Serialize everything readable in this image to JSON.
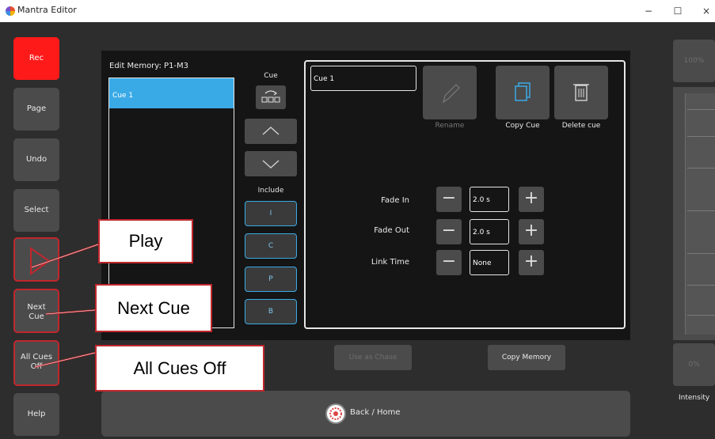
{
  "window": {
    "title": "Mantra Editor",
    "minimize": "−",
    "maximize": "☐",
    "close": "×"
  },
  "sidebar": {
    "rec": "Rec",
    "page": "Page",
    "undo": "Undo",
    "select": "Select",
    "next_cue": "Next\nCue",
    "all_cues_off": "All Cues\nOff",
    "help": "Help"
  },
  "editor": {
    "title": "Edit Memory: P1-M3",
    "cue_list": [
      "Cue 1"
    ],
    "cue_column_label": "Cue",
    "include_label": "Include",
    "include_buttons": [
      "I",
      "C",
      "P",
      "B"
    ]
  },
  "detail": {
    "cue_name": "Cue 1",
    "rename_label": "Rename",
    "copy_cue_label": "Copy Cue",
    "delete_cue_label": "Delete cue",
    "fade_in_label": "Fade In",
    "fade_in_value": "2.0 s",
    "fade_out_label": "Fade Out",
    "fade_out_value": "2.0 s",
    "link_time_label": "Link Time",
    "link_time_value": "None"
  },
  "bottom": {
    "use_as_chase": "Use as Chase",
    "copy_memory": "Copy Memory",
    "back_home": "Back / Home"
  },
  "right": {
    "top_value": "100%",
    "bottom_value": "0%",
    "intensity_label": "Intensity"
  },
  "callouts": {
    "play": "Play",
    "next_cue": "Next Cue",
    "all_cues_off": "All Cues Off"
  },
  "colors": {
    "rec": "#ff1a1a",
    "selection": "#3aaae6",
    "callout_border": "#c0272d"
  }
}
